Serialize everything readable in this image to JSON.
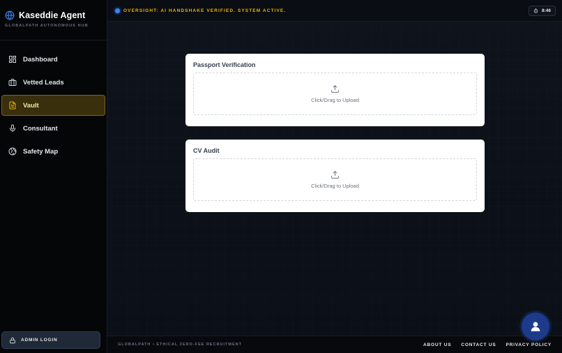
{
  "brand": {
    "title": "Kaseddie Agent",
    "subtitle": "GLOBALPATH AUTONOMOUS HUB",
    "icon": "globe-icon"
  },
  "nav": {
    "items": [
      {
        "label": "Dashboard",
        "icon": "dashboard-icon",
        "active": false
      },
      {
        "label": "Vetted Leads",
        "icon": "briefcase-icon",
        "active": false
      },
      {
        "label": "Vault",
        "icon": "document-icon",
        "active": true
      },
      {
        "label": "Consultant",
        "icon": "microphone-icon",
        "active": false
      },
      {
        "label": "Safety Map",
        "icon": "globe-map-icon",
        "active": false
      }
    ]
  },
  "admin": {
    "label": "ADMIN LOGIN",
    "icon": "lock-icon"
  },
  "topbar": {
    "status": "OVERSIGHT: AI HANDSHAKE VERIFIED. SYSTEM ACTIVE.",
    "time": "8:46"
  },
  "cards": [
    {
      "title": "Passport Verification",
      "upload_label": "Click/Drag to Upload"
    },
    {
      "title": "CV Audit",
      "upload_label": "Click/Drag to Upload"
    }
  ],
  "footer": {
    "tagline": "GLOBALPATH • ETHICAL ZERO-FEE RECRUITMENT",
    "links": [
      "ABOUT US",
      "CONTACT US",
      "PRIVACY POLICY"
    ]
  },
  "colors": {
    "accent": "#eab308",
    "active_bg": "#3a2f0c",
    "fab": "#1e3a8a",
    "status_dot": "#3b82f6"
  }
}
